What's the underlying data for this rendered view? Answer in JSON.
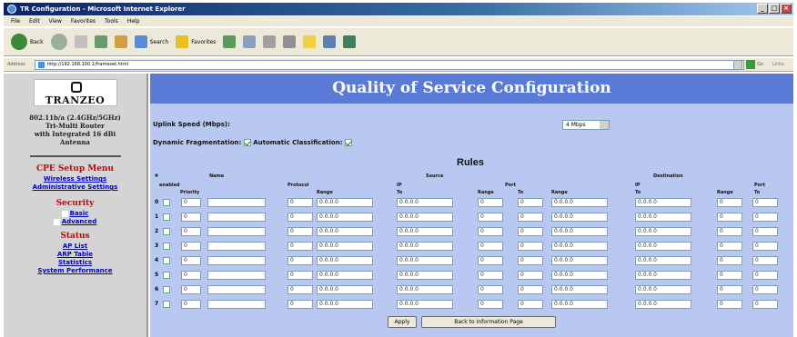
{
  "window": {
    "title": "TR Configuration - Microsoft Internet Explorer"
  },
  "menubar": [
    "File",
    "Edit",
    "View",
    "Favorites",
    "Tools",
    "Help"
  ],
  "toolbar": {
    "back": "Back",
    "search": "Search",
    "favorites": "Favorites"
  },
  "address": {
    "label": "Address",
    "url": "http://192.168.100.1/frameset.html",
    "go": "Go",
    "links": "Links"
  },
  "sidebar": {
    "logo": "TRANZEO",
    "description": [
      "802.11b/a (2.4GHz/5GHz)",
      "Tri-Multi Router",
      "with Integrated 16 dBi",
      "Antenna"
    ],
    "cpe_heading": "CPE Setup Menu",
    "cpe_links": [
      "Wireless Settings",
      "Administrative Settings"
    ],
    "security_heading": "Security",
    "security_links": [
      "Basic",
      "Advanced"
    ],
    "status_heading": "Status",
    "status_links": [
      "AP List",
      "ARP Table",
      "Statistics",
      "System Performance"
    ]
  },
  "main": {
    "title": "Quality of Service Configuration",
    "uplink_label": "Uplink Speed (Mbps):",
    "uplink_value": "4 Mbps",
    "frag_label": "Dynamic Fragmentation:",
    "auto_label": "Automatic Classification:",
    "rules_title": "Rules",
    "headers": {
      "num": "#",
      "enabled": "enabled",
      "priority": "Priority",
      "name": "Name",
      "protocol": "Protocol",
      "range": "Range",
      "source": "Source",
      "ip": "IP",
      "to": "To",
      "port": "Port",
      "destination": "Destination"
    },
    "rows": [
      {
        "n": "0",
        "priority": "0",
        "protocol": "0",
        "src_ip": "0.0.0.0",
        "src_ip_to": "0.0.0.0",
        "src_port": "0",
        "src_port_to": "0",
        "dst_ip": "0.0.0.0",
        "dst_ip_to": "0.0.0.0",
        "dst_port": "0",
        "dst_port_to": "0"
      },
      {
        "n": "1",
        "priority": "0",
        "protocol": "0",
        "src_ip": "0.0.0.0",
        "src_ip_to": "0.0.0.0",
        "src_port": "0",
        "src_port_to": "0",
        "dst_ip": "0.0.0.0",
        "dst_ip_to": "0.0.0.0",
        "dst_port": "0",
        "dst_port_to": "0"
      },
      {
        "n": "2",
        "priority": "0",
        "protocol": "0",
        "src_ip": "0.0.0.0",
        "src_ip_to": "0.0.0.0",
        "src_port": "0",
        "src_port_to": "0",
        "dst_ip": "0.0.0.0",
        "dst_ip_to": "0.0.0.0",
        "dst_port": "0",
        "dst_port_to": "0"
      },
      {
        "n": "3",
        "priority": "0",
        "protocol": "0",
        "src_ip": "0.0.0.0",
        "src_ip_to": "0.0.0.0",
        "src_port": "0",
        "src_port_to": "0",
        "dst_ip": "0.0.0.0",
        "dst_ip_to": "0.0.0.0",
        "dst_port": "0",
        "dst_port_to": "0"
      },
      {
        "n": "4",
        "priority": "0",
        "protocol": "0",
        "src_ip": "0.0.0.0",
        "src_ip_to": "0.0.0.0",
        "src_port": "0",
        "src_port_to": "0",
        "dst_ip": "0.0.0.0",
        "dst_ip_to": "0.0.0.0",
        "dst_port": "0",
        "dst_port_to": "0"
      },
      {
        "n": "5",
        "priority": "0",
        "protocol": "0",
        "src_ip": "0.0.0.0",
        "src_ip_to": "0.0.0.0",
        "src_port": "0",
        "src_port_to": "0",
        "dst_ip": "0.0.0.0",
        "dst_ip_to": "0.0.0.0",
        "dst_port": "0",
        "dst_port_to": "0"
      },
      {
        "n": "6",
        "priority": "0",
        "protocol": "0",
        "src_ip": "0.0.0.0",
        "src_ip_to": "0.0.0.0",
        "src_port": "0",
        "src_port_to": "0",
        "dst_ip": "0.0.0.0",
        "dst_ip_to": "0.0.0.0",
        "dst_port": "0",
        "dst_port_to": "0"
      },
      {
        "n": "7",
        "priority": "0",
        "protocol": "0",
        "src_ip": "0.0.0.0",
        "src_ip_to": "0.0.0.0",
        "src_port": "0",
        "src_port_to": "0",
        "dst_ip": "0.0.0.0",
        "dst_ip_to": "0.0.0.0",
        "dst_port": "0",
        "dst_port_to": "0"
      }
    ],
    "apply_label": "Apply",
    "back_label": "Back to Information Page"
  },
  "colors": {
    "banner": "#5a7ad8",
    "panel": "#b9c8f0",
    "sidebar": "#d4d4d4",
    "menu_heading": "#d00000",
    "link": "#0000cc"
  }
}
